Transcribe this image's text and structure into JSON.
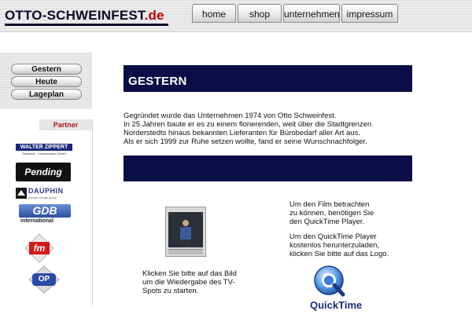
{
  "header": {
    "logo_main": "OTTO-SCHWEINFEST",
    "logo_tld": ".de",
    "nav": [
      {
        "label": "home"
      },
      {
        "label": "shop"
      },
      {
        "label": "unternehmen"
      },
      {
        "label": "impressum"
      }
    ]
  },
  "sidebar": {
    "buttons": [
      {
        "label": "Gestern"
      },
      {
        "label": "Heute"
      },
      {
        "label": "Lageplan"
      }
    ],
    "partner_heading": "Partner",
    "partners": [
      {
        "name": "WALTER ZIPPERT",
        "tagline": "Tischlerei · Innenausbau GmbH"
      },
      {
        "name": "Pending"
      },
      {
        "name": "DAUPHIN",
        "tagline": "human design group"
      },
      {
        "name": "GDB",
        "tagline": "international"
      },
      {
        "name": "fm"
      },
      {
        "name": "OP"
      }
    ]
  },
  "main": {
    "section_title": "GESTERN",
    "intro_lines": [
      "Gegründet wurde das Unternehmen 1974 von Otto Schweinfest.",
      "In 25 Jahren baute er es zu einem florierenden, weit über die Stadtgrenzen",
      "Norderstedts hinaus bekannten Lieferanten für Bürobedarf aller Art aus.",
      "Als er sich 1999 zur Ruhe setzen wollte, fand er seine Wunschnachfolger."
    ],
    "video_caption_lines": [
      "Klicken Sie bitte auf das Bild",
      "um die Wiedergabe des TV-",
      "Spots zu starten."
    ],
    "quicktime_info": [
      [
        "Um den Film betrachten",
        "zu können, benötigen Sie",
        "den QuickTime Player."
      ],
      [
        "Um den QuickTime Player",
        "kostenlos herunterzuladen,",
        "klicken Sie bitte auf das Logo."
      ]
    ],
    "quicktime_logo_text": "QuickTime"
  },
  "colors": {
    "dark_navy": "#0a0d46",
    "logo_red": "#c00000",
    "partner_red": "#b01818"
  }
}
